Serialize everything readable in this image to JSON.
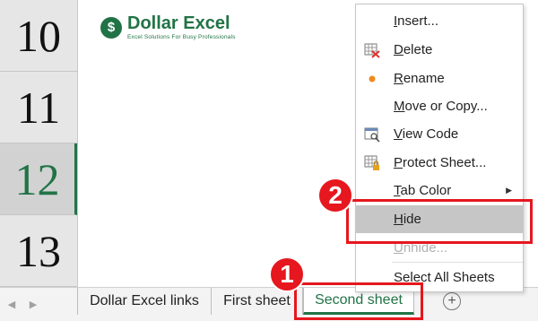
{
  "rows": [
    "10",
    "11",
    "12",
    "13"
  ],
  "selected_row": "12",
  "logo": {
    "icon": "dollar-sign-icon",
    "symbol": "$",
    "title": "Dollar Excel",
    "subtitle": "Excel Solutions For Busy Professionals"
  },
  "sheet_nav": {
    "prev_icon": "chevron-left-icon",
    "next_icon": "chevron-right-icon",
    "prev": "◀",
    "next": "▶"
  },
  "tabs": [
    {
      "label": "Dollar Excel links",
      "active": false
    },
    {
      "label": "First sheet",
      "active": false
    },
    {
      "label": "Second sheet",
      "active": true
    }
  ],
  "add_sheet": {
    "icon": "plus-circle-icon",
    "symbol": "+"
  },
  "context_menu": {
    "items": [
      {
        "key": "insert",
        "pre": "",
        "ul": "I",
        "post": "nsert...",
        "icon": "",
        "disabled": false
      },
      {
        "key": "delete",
        "pre": "",
        "ul": "D",
        "post": "elete",
        "icon": "delete-sheet-icon",
        "disabled": false
      },
      {
        "key": "rename",
        "pre": "",
        "ul": "R",
        "post": "ename",
        "icon": "rename-dot-icon",
        "disabled": false
      },
      {
        "key": "move-copy",
        "pre": "",
        "ul": "M",
        "post": "ove or Copy...",
        "icon": "",
        "disabled": false
      },
      {
        "key": "view-code",
        "pre": "",
        "ul": "V",
        "post": "iew Code",
        "icon": "view-code-icon",
        "disabled": false
      },
      {
        "key": "protect-sheet",
        "pre": "",
        "ul": "P",
        "post": "rotect Sheet...",
        "icon": "protect-sheet-icon",
        "disabled": false
      },
      {
        "key": "tab-color",
        "pre": "",
        "ul": "T",
        "post": "ab Color",
        "icon": "",
        "disabled": false,
        "submenu": "▶"
      },
      {
        "key": "hide",
        "pre": "",
        "ul": "H",
        "post": "ide",
        "icon": "",
        "disabled": false,
        "highlighted": true
      },
      {
        "key": "unhide",
        "pre": "",
        "ul": "U",
        "post": "nhide...",
        "icon": "",
        "disabled": true
      },
      {
        "key": "select-all-sheets",
        "pre": "",
        "ul": "S",
        "post": "elect All Sheets",
        "icon": "",
        "disabled": false
      }
    ]
  },
  "annotations": {
    "step1": "1",
    "step2": "2",
    "accent": "#e6171e"
  },
  "colors": {
    "excel_green": "#217346",
    "highlight": "#c6c6c6"
  }
}
